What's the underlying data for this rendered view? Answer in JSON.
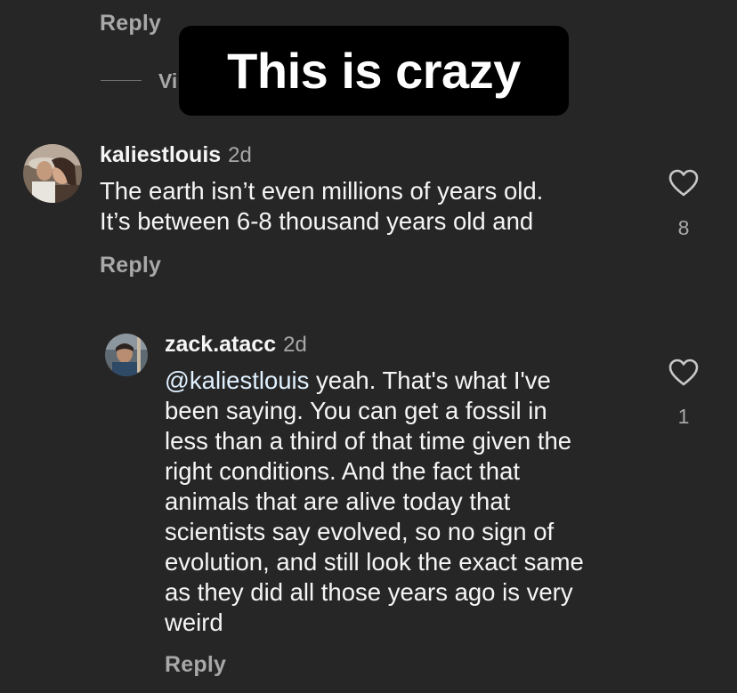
{
  "top_thread": {
    "reply_label": "Reply",
    "view_replies_label": "Vi"
  },
  "overlay_caption": "This is crazy",
  "comments": [
    {
      "username": "kaliestlouis",
      "time": "2d",
      "text": "The earth isn’t even millions of years old. It’s between 6-8 thousand years old and",
      "lines": [
        "The earth isn’t even millions of years old.",
        "It’s between 6-8 thousand years old and"
      ],
      "like_count": "8",
      "reply_label": "Reply",
      "avatar_icon": "profile-photo-couple"
    },
    {
      "username": "zack.atacc",
      "time": "2d",
      "mention": "@kaliestlouis",
      "text_after_mention": " yeah. That's what I've",
      "lines": [
        "been saying. You can get a fossil in",
        "less than a third of that time given the",
        "right conditions. And the fact that",
        "animals that are alive today that",
        "scientists say evolved, so no sign of",
        "evolution, and still look the exact same",
        "as they did all those years ago is very",
        "weird"
      ],
      "like_count": "1",
      "reply_label": "Reply",
      "avatar_icon": "profile-photo-man"
    }
  ],
  "colors": {
    "background": "#262626",
    "secondary_text": "#a8a8a8",
    "primary_text": "#f5f5f5",
    "overlay_bg": "#000000"
  }
}
